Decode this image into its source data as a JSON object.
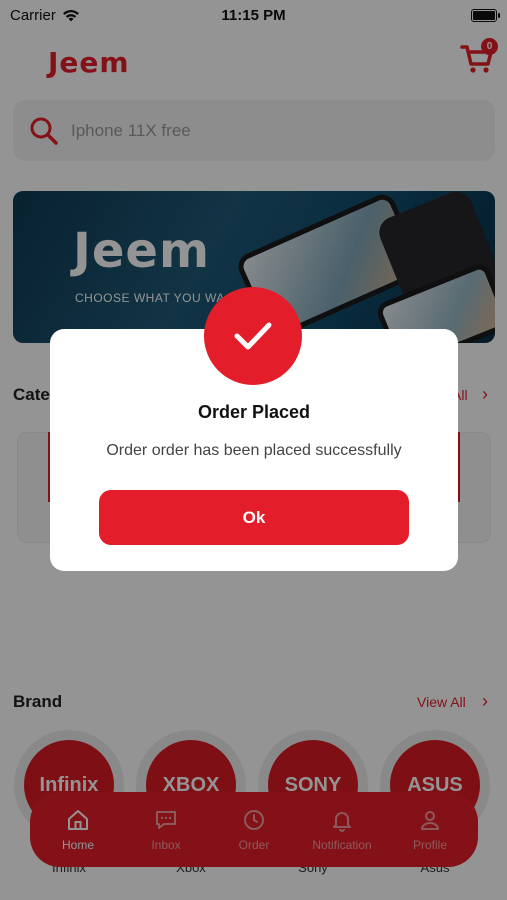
{
  "status_bar": {
    "carrier": "Carrier",
    "time": "11:15 PM"
  },
  "header": {
    "logo": "Jeem",
    "cart_count": "0"
  },
  "search": {
    "placeholder": "Iphone 11X free"
  },
  "banner": {
    "logo": "Jeem",
    "tagline": "CHOOSE WHAT YOU WA"
  },
  "categories": {
    "title": "Cate",
    "view_all": "All"
  },
  "brand_section": {
    "title": "Brand",
    "view_all": "View All",
    "items": [
      {
        "logo": "Infinix",
        "name": "Infinix"
      },
      {
        "logo": "XBOX",
        "name": "Xbox"
      },
      {
        "logo": "SONY",
        "name": "Sony"
      },
      {
        "logo": "ASUS",
        "name": "Asus"
      }
    ]
  },
  "bottom_nav": {
    "items": [
      {
        "label": "Home",
        "icon": "home-icon",
        "active": true
      },
      {
        "label": "Inbox",
        "icon": "chat-icon",
        "active": false
      },
      {
        "label": "Order",
        "icon": "clock-icon",
        "active": false
      },
      {
        "label": "Notification",
        "icon": "bell-icon",
        "active": false
      },
      {
        "label": "Profile",
        "icon": "user-icon",
        "active": false
      }
    ]
  },
  "dialog": {
    "title": "Order Placed",
    "message": "Order order has been placed successfully",
    "ok_label": "Ok",
    "icon": "checkmark-icon"
  },
  "colors": {
    "accent": "#e31e2a"
  }
}
